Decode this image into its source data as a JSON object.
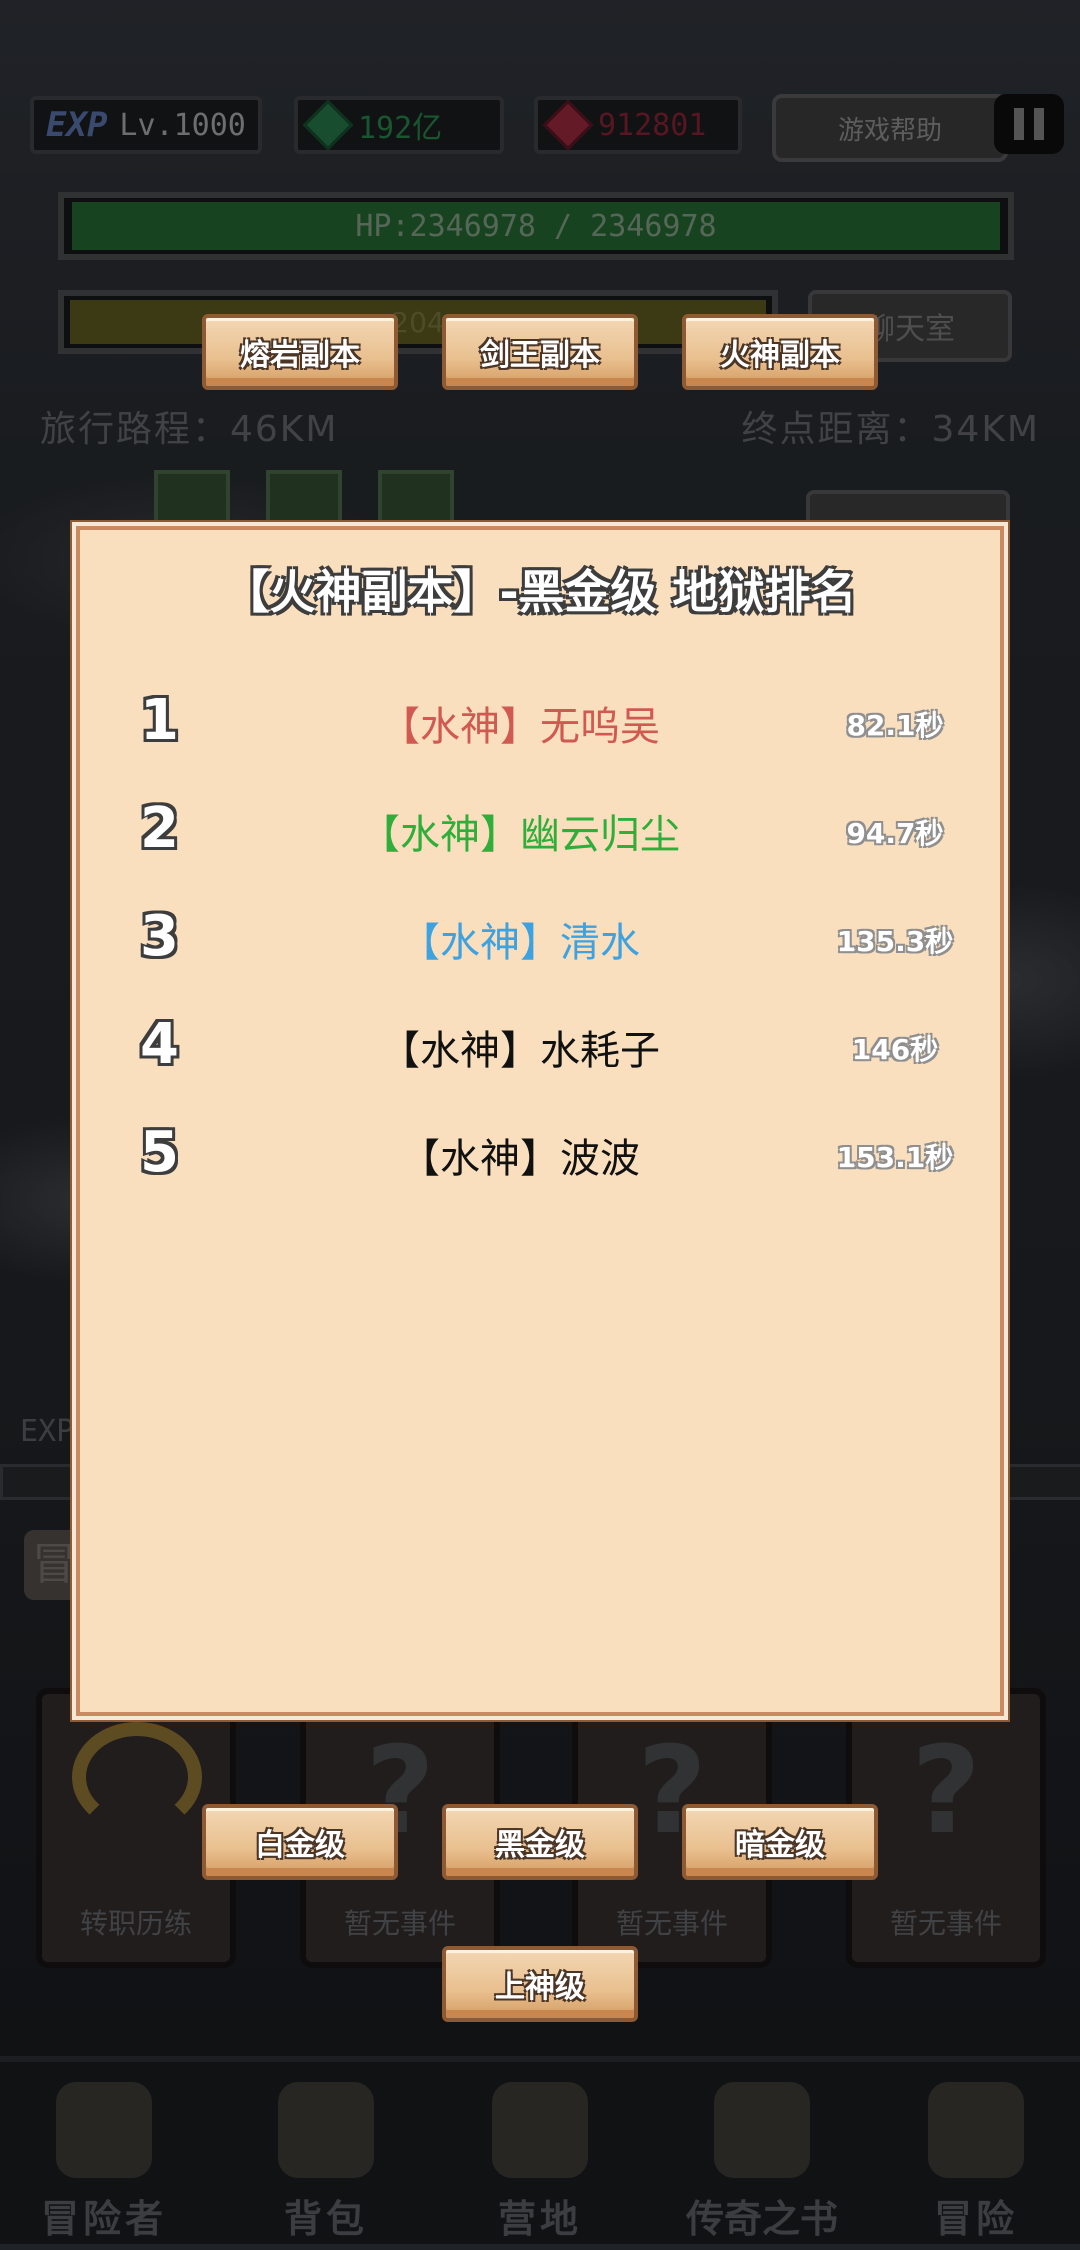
{
  "hud": {
    "exp_badge": "EXP",
    "level": "Lv.1000",
    "green_currency": "192亿",
    "red_currency": "912801",
    "help_button": "游戏帮助",
    "hp_text": "HP:2346978 / 2346978",
    "hp_fraction": 1.0,
    "xp_text": "204",
    "chat_button": "聊天室",
    "travel_distance": "旅行路程：46KM",
    "destination_distance": "终点距离：34KM"
  },
  "dungeon_tabs": [
    "熔岩副本",
    "剑王副本",
    "火神副本"
  ],
  "panel": {
    "title": "【火神副本】-黑金级 地狱排名",
    "rankings": [
      {
        "rank": "1",
        "name": "【水神】无呜吴",
        "time": "82.1秒",
        "color": "#d05a52"
      },
      {
        "rank": "2",
        "name": "【水神】幽云归尘",
        "time": "94.7秒",
        "color": "#2fae3a"
      },
      {
        "rank": "3",
        "name": "【水神】清水",
        "time": "135.3秒",
        "color": "#3ea2e0"
      },
      {
        "rank": "4",
        "name": "【水神】水耗子",
        "time": "146秒",
        "color": "#111111"
      },
      {
        "rank": "5",
        "name": "【水神】波波",
        "time": "153.1秒",
        "color": "#111111"
      }
    ]
  },
  "tier_buttons": [
    "白金级",
    "黑金级",
    "暗金级",
    "上神级"
  ],
  "background": {
    "exp_label": "EXP",
    "adventure_partial": "冒",
    "events": [
      "转职历练",
      "暂无事件",
      "暂无事件",
      "暂无事件"
    ]
  },
  "bottom_nav": [
    {
      "label": "冒险者",
      "icon": "helmet-icon"
    },
    {
      "label": "背包",
      "icon": "backpack-icon"
    },
    {
      "label": "营地",
      "icon": "camp-banner-icon"
    },
    {
      "label": "传奇之书",
      "icon": "legend-book-icon"
    },
    {
      "label": "冒险",
      "icon": "sword-icon"
    }
  ]
}
